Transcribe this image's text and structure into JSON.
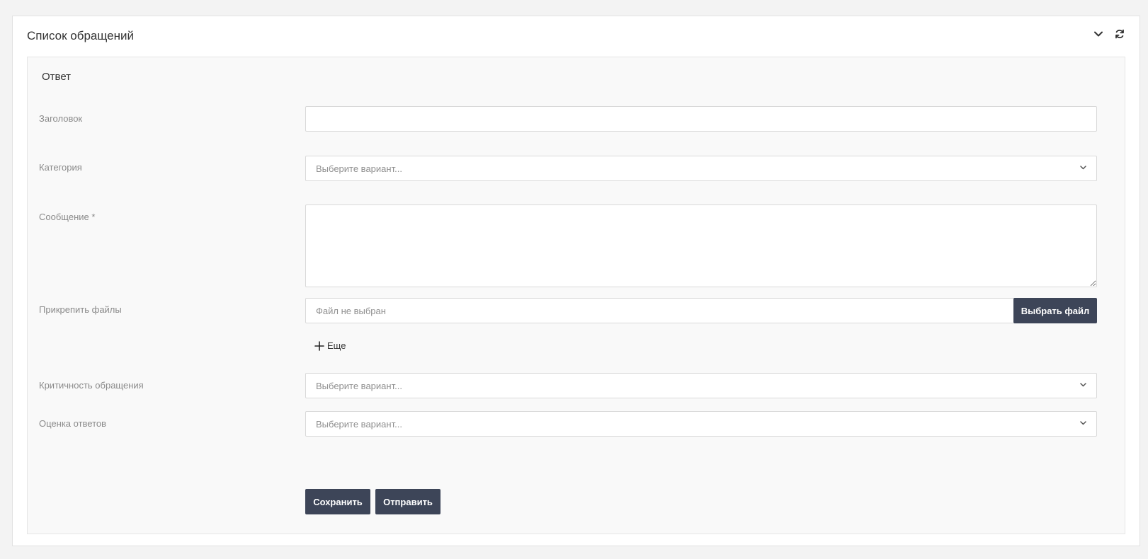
{
  "card": {
    "title": "Список обращений",
    "tools": {
      "collapse_icon": "chevron-down-icon",
      "refresh_icon": "refresh-icon"
    }
  },
  "form": {
    "legend": "Ответ",
    "title_field": {
      "label": "Заголовок",
      "value": ""
    },
    "category": {
      "label": "Категория",
      "placeholder": "Выберите вариант..."
    },
    "message": {
      "label": "Сообщение *",
      "value": ""
    },
    "attach": {
      "label": "Прикрепить файлы",
      "file_text": "Файл не выбран",
      "button_label": "Выбрать файл",
      "more_label": "Еще"
    },
    "criticality": {
      "label": "Критичность обращения",
      "placeholder": "Выберите вариант..."
    },
    "rating": {
      "label": "Оценка ответов",
      "placeholder": "Выберите вариант..."
    },
    "actions": {
      "save_label": "Сохранить",
      "send_label": "Отправить"
    }
  },
  "colors": {
    "button": "#3d4558",
    "background": "#f3f3f3",
    "panel": "#f9f9f9"
  }
}
